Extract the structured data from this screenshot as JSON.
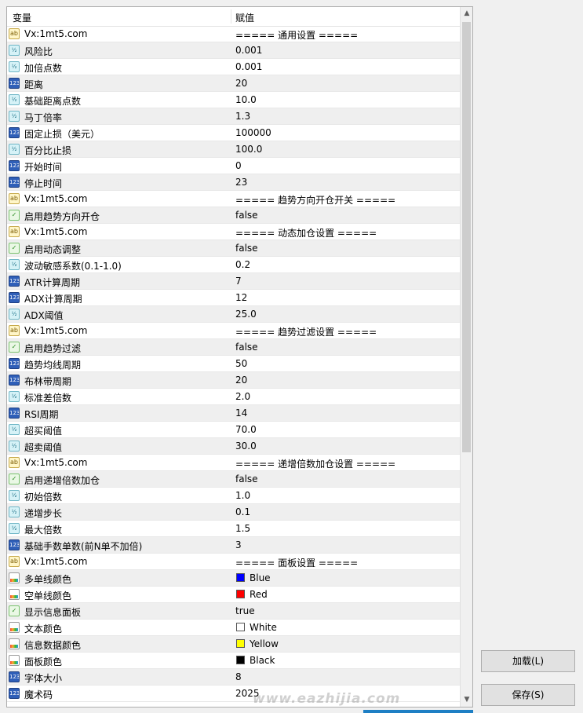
{
  "table": {
    "col_variable": "变量",
    "col_value": "赋值",
    "rows": [
      {
        "type": "string",
        "name": "Vx:1mt5.com",
        "value": "===== 通用设置 ====="
      },
      {
        "type": "double",
        "name": "风险比",
        "value": "0.001"
      },
      {
        "type": "double",
        "name": "加倍点数",
        "value": "0.001"
      },
      {
        "type": "int",
        "name": "距离",
        "value": "20"
      },
      {
        "type": "double",
        "name": "基础距离点数",
        "value": "10.0"
      },
      {
        "type": "double",
        "name": "马丁倍率",
        "value": "1.3"
      },
      {
        "type": "int",
        "name": "固定止损（美元）",
        "value": "100000"
      },
      {
        "type": "double",
        "name": "百分比止损",
        "value": "100.0"
      },
      {
        "type": "int",
        "name": "开始时间",
        "value": "0"
      },
      {
        "type": "int",
        "name": "停止时间",
        "value": "23"
      },
      {
        "type": "string",
        "name": "Vx:1mt5.com",
        "value": "===== 趋势方向开仓开关 ====="
      },
      {
        "type": "bool",
        "name": "启用趋势方向开仓",
        "value": "false"
      },
      {
        "type": "string",
        "name": "Vx:1mt5.com",
        "value": "===== 动态加仓设置 ====="
      },
      {
        "type": "bool",
        "name": "启用动态调整",
        "value": "false"
      },
      {
        "type": "double",
        "name": "波动敏感系数(0.1-1.0)",
        "value": "0.2"
      },
      {
        "type": "int",
        "name": "ATR计算周期",
        "value": "7"
      },
      {
        "type": "int",
        "name": "ADX计算周期",
        "value": "12"
      },
      {
        "type": "double",
        "name": "ADX阈值",
        "value": "25.0"
      },
      {
        "type": "string",
        "name": "Vx:1mt5.com",
        "value": "===== 趋势过滤设置 ====="
      },
      {
        "type": "bool",
        "name": "启用趋势过滤",
        "value": "false"
      },
      {
        "type": "int",
        "name": "趋势均线周期",
        "value": "50"
      },
      {
        "type": "int",
        "name": "布林带周期",
        "value": "20"
      },
      {
        "type": "double",
        "name": "标准差倍数",
        "value": "2.0"
      },
      {
        "type": "int",
        "name": "RSI周期",
        "value": "14"
      },
      {
        "type": "double",
        "name": "超买阈值",
        "value": "70.0"
      },
      {
        "type": "double",
        "name": "超卖阈值",
        "value": "30.0"
      },
      {
        "type": "string",
        "name": "Vx:1mt5.com",
        "value": "===== 递增倍数加仓设置 ====="
      },
      {
        "type": "bool",
        "name": "启用递增倍数加仓",
        "value": "false"
      },
      {
        "type": "double",
        "name": "初始倍数",
        "value": "1.0"
      },
      {
        "type": "double",
        "name": "递增步长",
        "value": "0.1"
      },
      {
        "type": "double",
        "name": "最大倍数",
        "value": "1.5"
      },
      {
        "type": "int",
        "name": "基础手数单数(前N单不加倍)",
        "value": "3"
      },
      {
        "type": "string",
        "name": "Vx:1mt5.com",
        "value": "===== 面板设置 ====="
      },
      {
        "type": "color",
        "name": "多单线颜色",
        "value": "Blue",
        "swatch": "#0000ff"
      },
      {
        "type": "color",
        "name": "空单线颜色",
        "value": "Red",
        "swatch": "#ff0000"
      },
      {
        "type": "bool",
        "name": "显示信息面板",
        "value": "true"
      },
      {
        "type": "color",
        "name": "文本颜色",
        "value": "White",
        "swatch": "#ffffff"
      },
      {
        "type": "color",
        "name": "信息数据颜色",
        "value": "Yellow",
        "swatch": "#ffff00"
      },
      {
        "type": "color",
        "name": "面板颜色",
        "value": "Black",
        "swatch": "#000000"
      },
      {
        "type": "int",
        "name": "字体大小",
        "value": "8"
      },
      {
        "type": "int",
        "name": "魔术码",
        "value": "2025"
      }
    ]
  },
  "icons": {
    "string": "ab",
    "double": "½",
    "int": "123",
    "bool": "✓",
    "color": ""
  },
  "buttons": {
    "load": "加载(L)",
    "save": "保存(S)"
  },
  "watermark": "www.eazhijia.com"
}
